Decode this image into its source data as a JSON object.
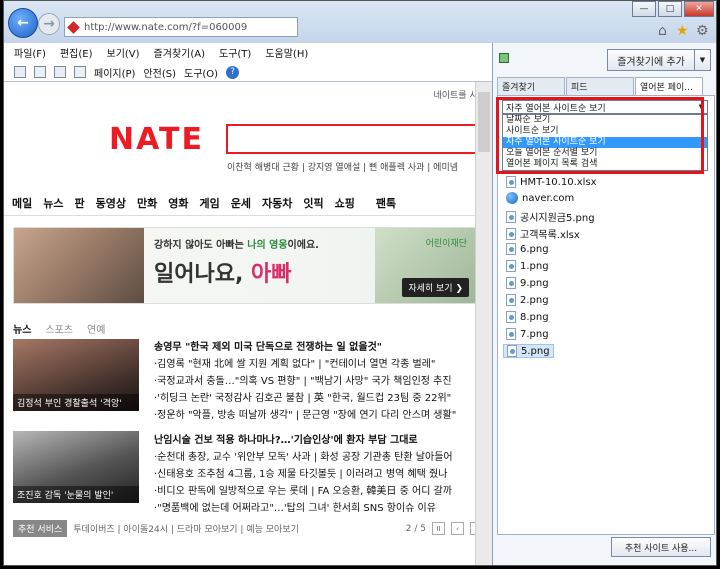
{
  "browser": {
    "url": "http://www.nate.com/?f=060009",
    "menu": [
      "파일(F)",
      "편집(E)",
      "보기(V)",
      "즐겨찾기(A)",
      "도구(T)",
      "도움말(H)"
    ],
    "command": {
      "page": "페이지(P)",
      "safety": "안전(S)",
      "tools": "도구(O)",
      "help": "?"
    },
    "window_controls": {
      "min": "—",
      "max": "□",
      "close": "✕"
    }
  },
  "page": {
    "top_link": "네이트를 시작",
    "logo": "NATE",
    "trending": "이찬혁 해병대 근황 | 강지영 열애설 | 삔 애플렉 사과 | 에미넴",
    "categories": [
      "메일",
      "뉴스",
      "판",
      "동영상",
      "만화",
      "영화",
      "게임",
      "운세",
      "자동차",
      "잇픽",
      "쇼핑",
      "팬톡"
    ],
    "banner": {
      "line1_pre": "강하지 않아도 아빠는 ",
      "line1_hl": "나의 영웅",
      "line1_post": "이에요.",
      "line2_pre": "일어나요, ",
      "line2_hl": "아빠",
      "brand": "어린이재단",
      "cta": "자세히 보기 ❯"
    },
    "news_tabs": [
      "뉴스",
      "스포츠",
      "연예"
    ],
    "thumb1_caption": "김정석 부인 경찰출석 '격앙'",
    "thumb2_caption": "조진호 감독 '눈물의 발인'",
    "headlines_1": [
      "송영무 \"한국 제외 미국 단독으로 전쟁하는 일 없을것\"",
      "·김영록 \"현재 北에 쌀 지원 계획 없다\" | \"컨테이너 열면 각종 벌레\"",
      "·국정교과서 충돌…\"의혹 VS 편향\" | \"백남기 사망\" 국가 책임인정 추진",
      "·'히딩크 논란' 국정감사 김호곤 불참 | 英 \"한국, 월드컵 23팀 중 22위\"",
      "·정운하 \"악플, 방송 떠날까 생각\" | 문근영 \"장에 연기 다리 안스며 생활\""
    ],
    "headlines_2": [
      "난임시술 건보 적용 하나마나?…'기습인상'에 환자 부담 그대로",
      "·순천대 총장, 교수 '위안부 모독' 사과 | 화성 공장 기관총 탄환 날아들어",
      "·신태용호 조추첨 4그룹, 1승 제물 타깃볼듯 | 이러려고 병역 혜택 줬나",
      "·비디오 판독에 일방적으로 우는 롯데 | FA 오승환, 韓美日 중 어디 갈까",
      "·\"명품백에 없는데 어쩌라고\"…'탑의 그녀' 한서희 SNS 항이슈 이유"
    ],
    "pager": {
      "selected": "추천 서비스",
      "items": "투데이버즈 | 아이돌24시 | 드라마 모아보기 | 예능 모아보기",
      "page": "2 / 5",
      "pause": "II",
      "prev": "‹",
      "next": "›"
    }
  },
  "panel": {
    "add_favorite": "즐겨찾기에 추가",
    "tabs": [
      "즐겨찾기",
      "피드",
      "열어본 페이..."
    ],
    "dropdown_selected": "자주 열어본 사이트순 보기",
    "dropdown_options": [
      "날짜순 보기",
      "사이트순 보기",
      "자주 열어본 사이트순 보기",
      "오늘 열어본 순서별 보기",
      "열어본 페이지 목록 검색"
    ],
    "history": [
      "HMT-10.10.xlsx",
      "naver.com",
      "공시지원금5.png",
      "고객목록.xlsx",
      "6.png",
      "1.png",
      "9.png",
      "2.png",
      "8.png",
      "7.png",
      "5.png"
    ],
    "suggested_sites": "추천 사이트 사용..."
  }
}
